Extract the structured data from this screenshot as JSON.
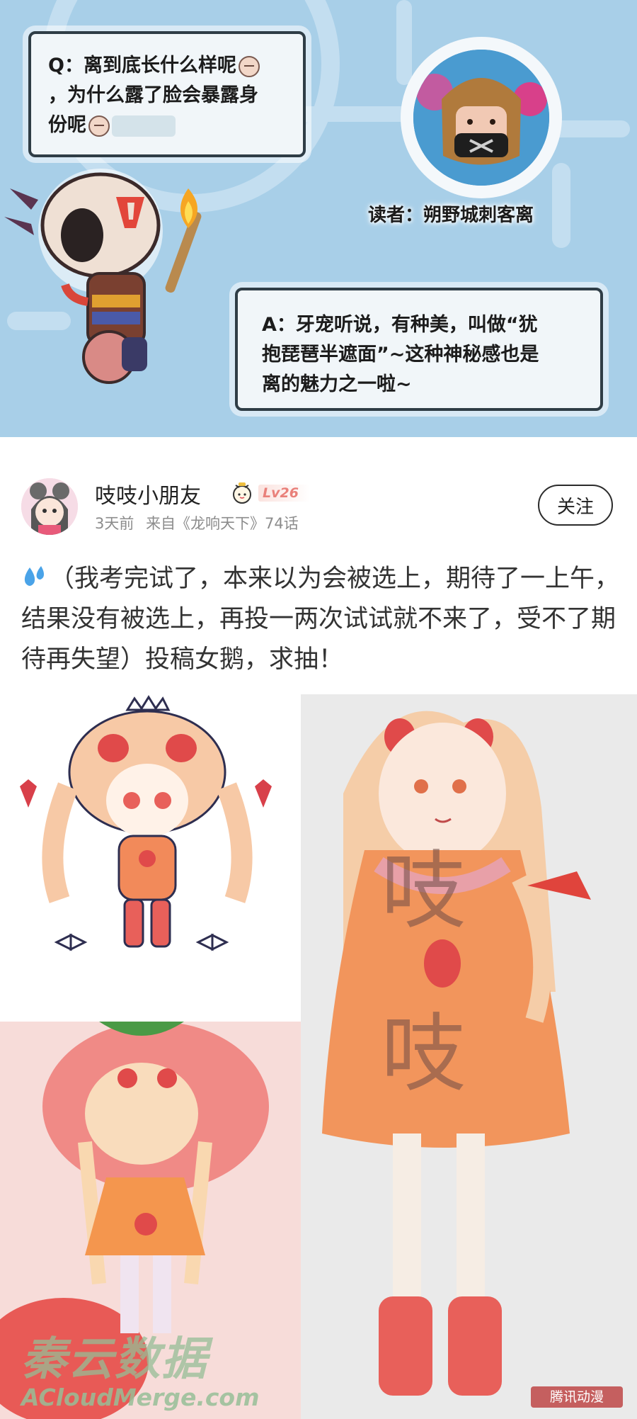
{
  "qa": {
    "question_lines": [
      "Q：离到底长什么样呢",
      "，为什么露了脸会暴露身",
      "份呢"
    ],
    "reader_label": "读者：朔野城刺客离",
    "answer_lines": [
      "A：牙宠听说，有种美，叫做“犹",
      "抱琵琶半遮面”~这种神秘感也是",
      "离的魅力之一啦~"
    ],
    "colors": {
      "panel_bg": "#a8cfe8",
      "bubble_border": "#2f3d46"
    }
  },
  "post": {
    "username": "吱吱小朋友",
    "level_badge": "Lv26",
    "time": "3天前",
    "source": "来自《龙响天下》74话",
    "follow_label": "关注",
    "body": "（我考完试了，本来以为会被选上，期待了一上午，结果没有被选上，再投一两次试试就不来了，受不了期待再失望）投稿女鹅，求抽！",
    "image_watermark_top": "吱",
    "image_watermark_bottom": "吱",
    "cloud_logo_cn": "秦云数据",
    "cloud_logo_en": "ACloudMerge.com",
    "site_logo": "腾讯动漫"
  },
  "icons": {
    "drop": "sweat-drops-icon",
    "badge": "alarm-clock-badge-icon"
  }
}
